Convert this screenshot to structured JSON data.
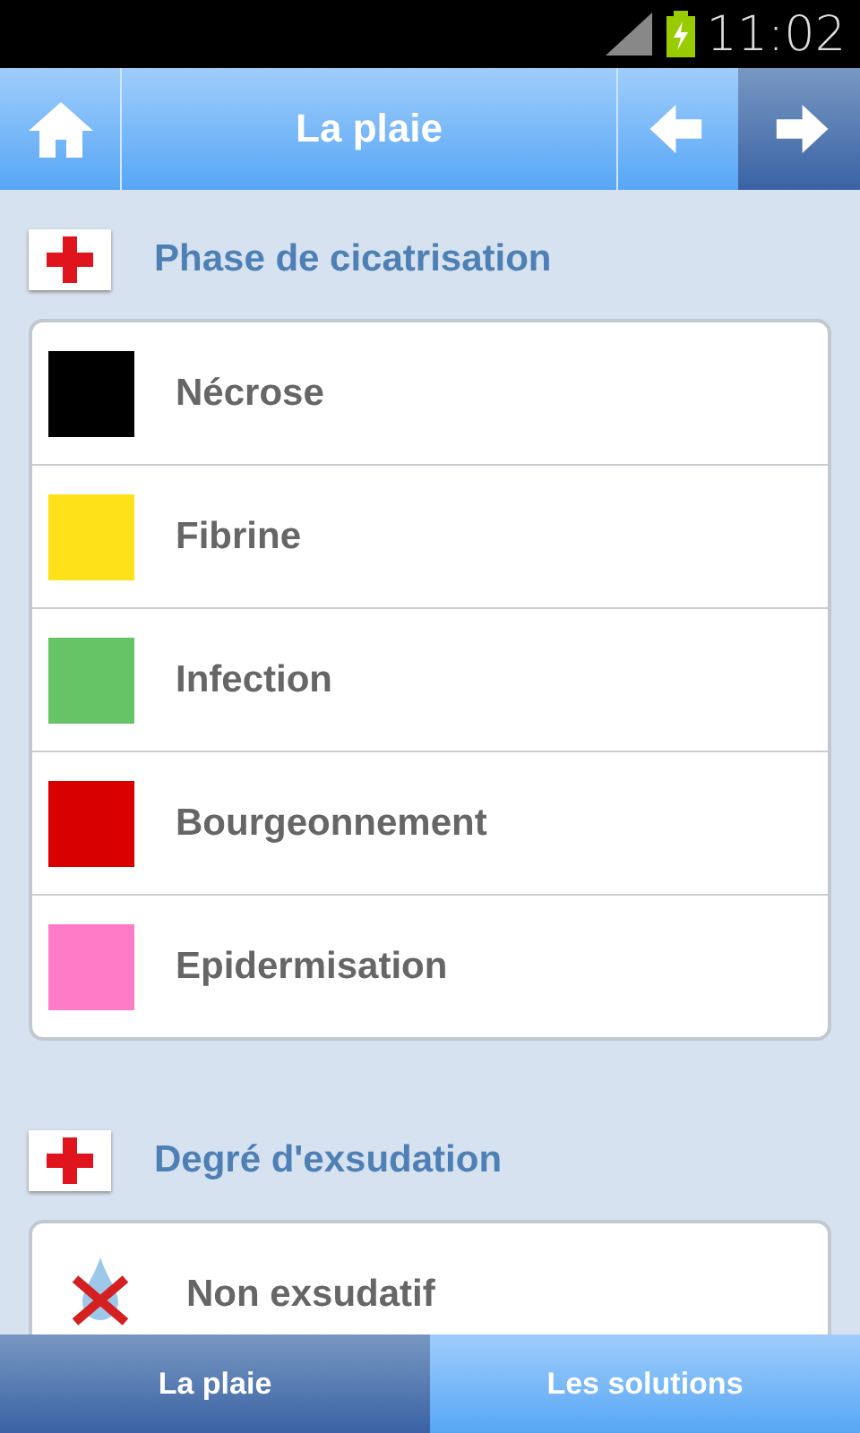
{
  "status_bar": {
    "time": "11:02"
  },
  "header": {
    "title": "La plaie",
    "nav_buttons": [
      {
        "kind": "back",
        "active": false
      },
      {
        "kind": "forward",
        "active": true
      }
    ]
  },
  "sections": [
    {
      "title": "Phase de cicatrisation",
      "items": [
        {
          "kind": "swatch",
          "label": "Nécrose",
          "color": "#000000"
        },
        {
          "kind": "swatch",
          "label": "Fibrine",
          "color": "#ffe11a"
        },
        {
          "kind": "swatch",
          "label": "Infection",
          "color": "#66c466"
        },
        {
          "kind": "swatch",
          "label": "Bourgeonnement",
          "color": "#d80000"
        },
        {
          "kind": "swatch",
          "label": "Epidermisation",
          "color": "#ff7bc8"
        }
      ]
    },
    {
      "title": "Degré d'exsudation",
      "items": [
        {
          "kind": "icon",
          "label": "Non exsudatif"
        }
      ]
    }
  ],
  "tabs": [
    {
      "label": "La plaie",
      "selected": true
    },
    {
      "label": "Les solutions",
      "selected": false
    }
  ]
}
